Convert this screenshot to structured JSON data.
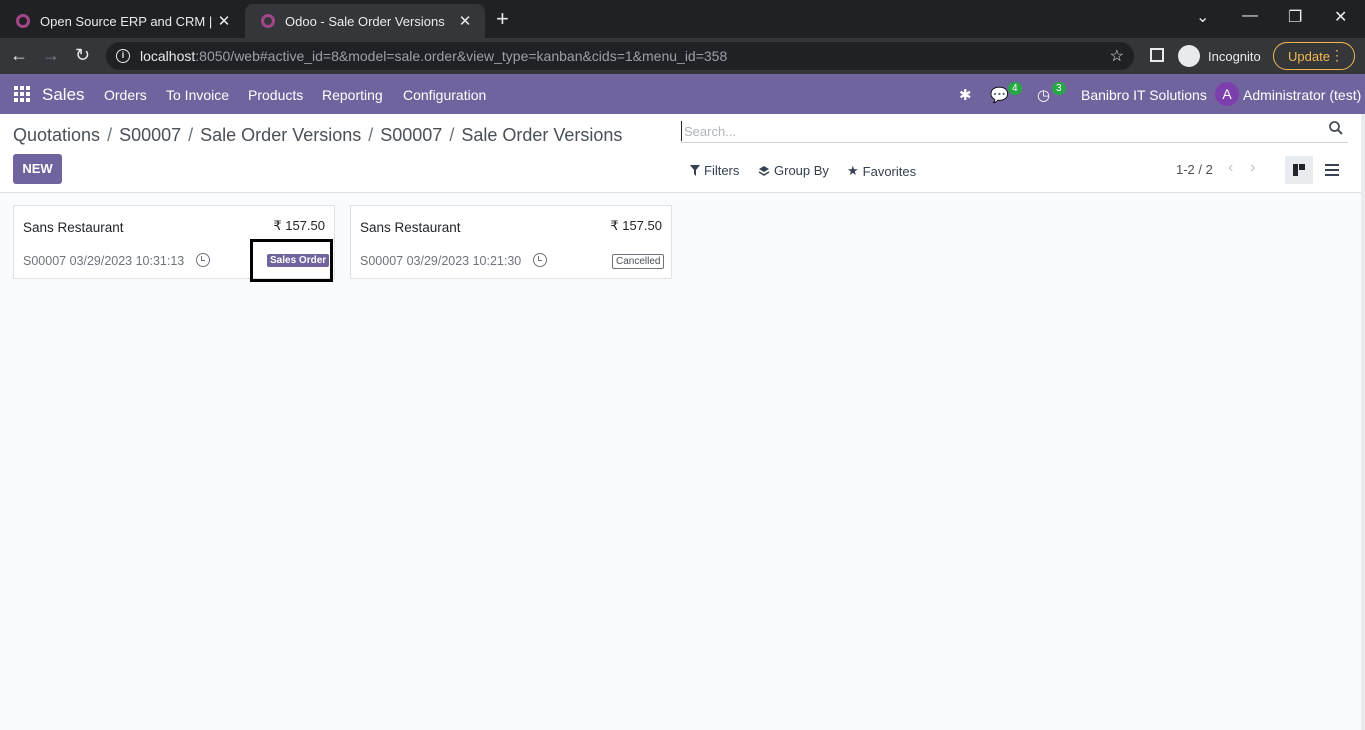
{
  "browser": {
    "tabs": [
      {
        "title": "Open Source ERP and CRM | Odoo",
        "active": false
      },
      {
        "title": "Odoo - Sale Order Versions",
        "active": true
      }
    ],
    "url_host": "localhost",
    "url_rest": ":8050/web#active_id=8&model=sale.order&view_type=kanban&cids=1&menu_id=358",
    "incognito_label": "Incognito",
    "update_label": "Update"
  },
  "navbar": {
    "app_name": "Sales",
    "menu": [
      "Orders",
      "To Invoice",
      "Products",
      "Reporting",
      "Configuration"
    ],
    "messages_count": "4",
    "activities_count": "3",
    "company": "Banibro IT Solutions",
    "avatar_letter": "A",
    "user": "Administrator (test)"
  },
  "control_panel": {
    "breadcrumbs": [
      "Quotations",
      "S00007",
      "Sale Order Versions",
      "S00007",
      "Sale Order Versions"
    ],
    "new_label": "NEW",
    "search_placeholder": "Search...",
    "filters_label": "Filters",
    "group_by_label": "Group By",
    "favorites_label": "Favorites",
    "pager": "1-2 / 2"
  },
  "records": [
    {
      "partner": "Sans Restaurant",
      "amount": "₹ 157.50",
      "ref": "S00007 03/29/2023 10:31:13",
      "state": "Sales Order"
    },
    {
      "partner": "Sans Restaurant",
      "amount": "₹ 157.50",
      "ref": "S00007 03/29/2023 10:21:30",
      "state": "Cancelled"
    }
  ],
  "colors": {
    "brand": "#71639e",
    "badge": "#28a745",
    "chrome_dark": "#202124",
    "update": "#f2b84b"
  },
  "icons": [
    "apps-grid-icon",
    "bug-icon",
    "chat-icon",
    "clock-icon",
    "filter-icon",
    "layers-icon",
    "star-icon",
    "search-icon",
    "kanban-view-icon",
    "list-view-icon"
  ]
}
